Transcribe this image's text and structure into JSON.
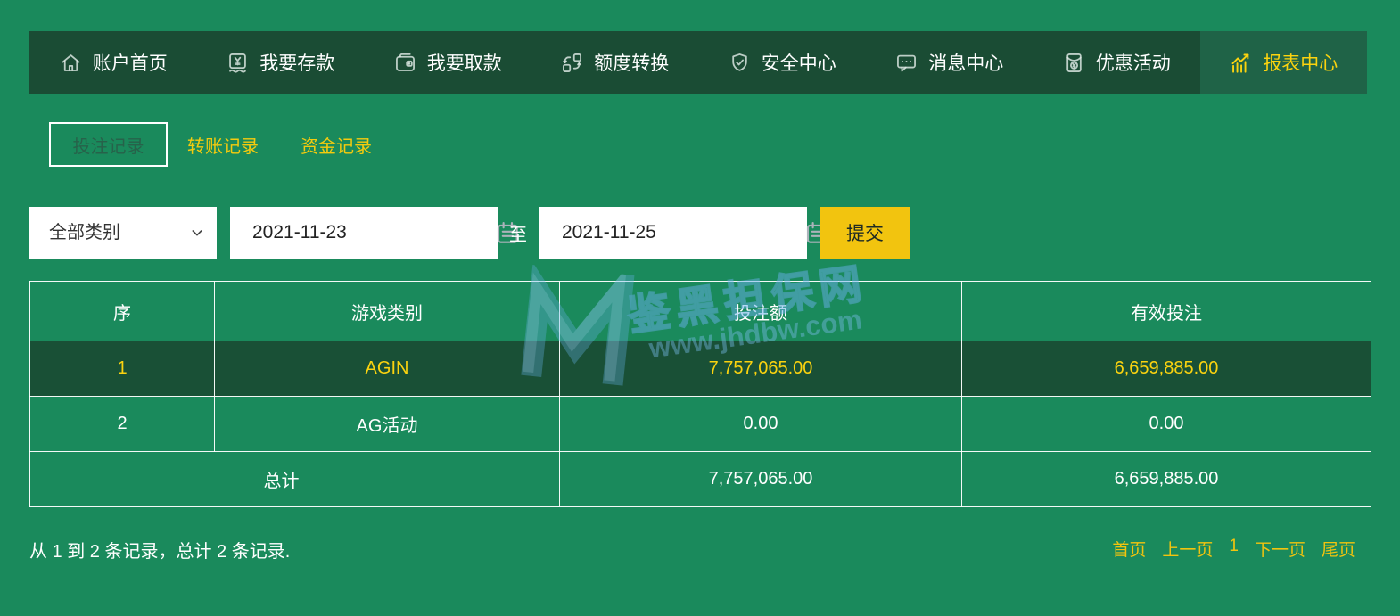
{
  "colors": {
    "page_bg": "#1A8A5C",
    "nav_bg": "#1A4C34",
    "nav_active_bg": "#1F6347",
    "accent_yellow": "#FBD30F",
    "submit_button_bg": "#F2C40F",
    "highlight_row_bg": "#195036",
    "watermark_blue": "#69AFEB"
  },
  "nav": {
    "items": [
      {
        "label": "账户首页",
        "icon": "home-icon",
        "active": false
      },
      {
        "label": "我要存款",
        "icon": "deposit-icon",
        "active": false
      },
      {
        "label": "我要取款",
        "icon": "withdraw-wallet-icon",
        "active": false
      },
      {
        "label": "额度转换",
        "icon": "transfer-swap-icon",
        "active": false
      },
      {
        "label": "安全中心",
        "icon": "shield-check-icon",
        "active": false
      },
      {
        "label": "消息中心",
        "icon": "message-bubble-icon",
        "active": false
      },
      {
        "label": "优惠活动",
        "icon": "promo-packet-icon",
        "active": false
      },
      {
        "label": "报表中心",
        "icon": "report-chart-icon",
        "active": true
      }
    ]
  },
  "tabs": [
    {
      "label": "投注记录",
      "active": true
    },
    {
      "label": "转账记录",
      "active": false
    },
    {
      "label": "资金记录",
      "active": false
    }
  ],
  "filters": {
    "category_select": {
      "value": "全部类别"
    },
    "date_from": {
      "value": "2021-11-23"
    },
    "date_separator": "至",
    "date_to": {
      "value": "2021-11-25"
    },
    "submit_label": "提交"
  },
  "table": {
    "headers": [
      "序",
      "游戏类别",
      "投注额",
      "有效投注"
    ],
    "rows": [
      {
        "index": "1",
        "game": "AGIN",
        "bet": "7,757,065.00",
        "valid": "6,659,885.00",
        "highlighted": true
      },
      {
        "index": "2",
        "game": "AG活动",
        "bet": "0.00",
        "valid": "0.00",
        "highlighted": false
      }
    ],
    "total": {
      "label": "总计",
      "bet": "7,757,065.00",
      "valid": "6,659,885.00"
    }
  },
  "footer": {
    "records_summary": "从 1 到 2 条记录，总计 2 条记录.",
    "pagination": [
      {
        "label": "首页"
      },
      {
        "label": "上一页"
      },
      {
        "label": "1"
      },
      {
        "label": "下一页"
      },
      {
        "label": "尾页"
      }
    ]
  },
  "watermark": {
    "title": "鉴黑担保网",
    "url": "www.jhdbw.com"
  }
}
